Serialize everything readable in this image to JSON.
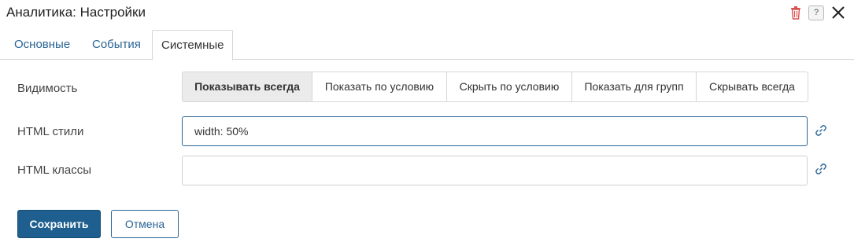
{
  "dialog": {
    "title": "Аналитика: Настройки",
    "help_symbol": "?"
  },
  "tabs": [
    {
      "label": "Основные"
    },
    {
      "label": "События"
    },
    {
      "label": "Системные",
      "active": true
    }
  ],
  "form": {
    "visibility": {
      "label": "Видимость",
      "options": [
        {
          "label": "Показывать всегда",
          "selected": true
        },
        {
          "label": "Показать по условию"
        },
        {
          "label": "Скрыть по условию"
        },
        {
          "label": "Показать для групп"
        },
        {
          "label": "Скрывать всегда"
        }
      ]
    },
    "html_styles": {
      "label": "HTML стили",
      "value": "width: 50%",
      "placeholder": ""
    },
    "html_classes": {
      "label": "HTML классы",
      "value": "",
      "placeholder": ""
    }
  },
  "buttons": {
    "save": "Сохранить",
    "cancel": "Отмена"
  },
  "colors": {
    "accent": "#1e5f8f",
    "link": "#2a6496",
    "delete": "#d9534f"
  },
  "icons": {
    "delete": "trash-icon",
    "help": "help-icon",
    "close": "close-icon",
    "link": "link-icon"
  }
}
